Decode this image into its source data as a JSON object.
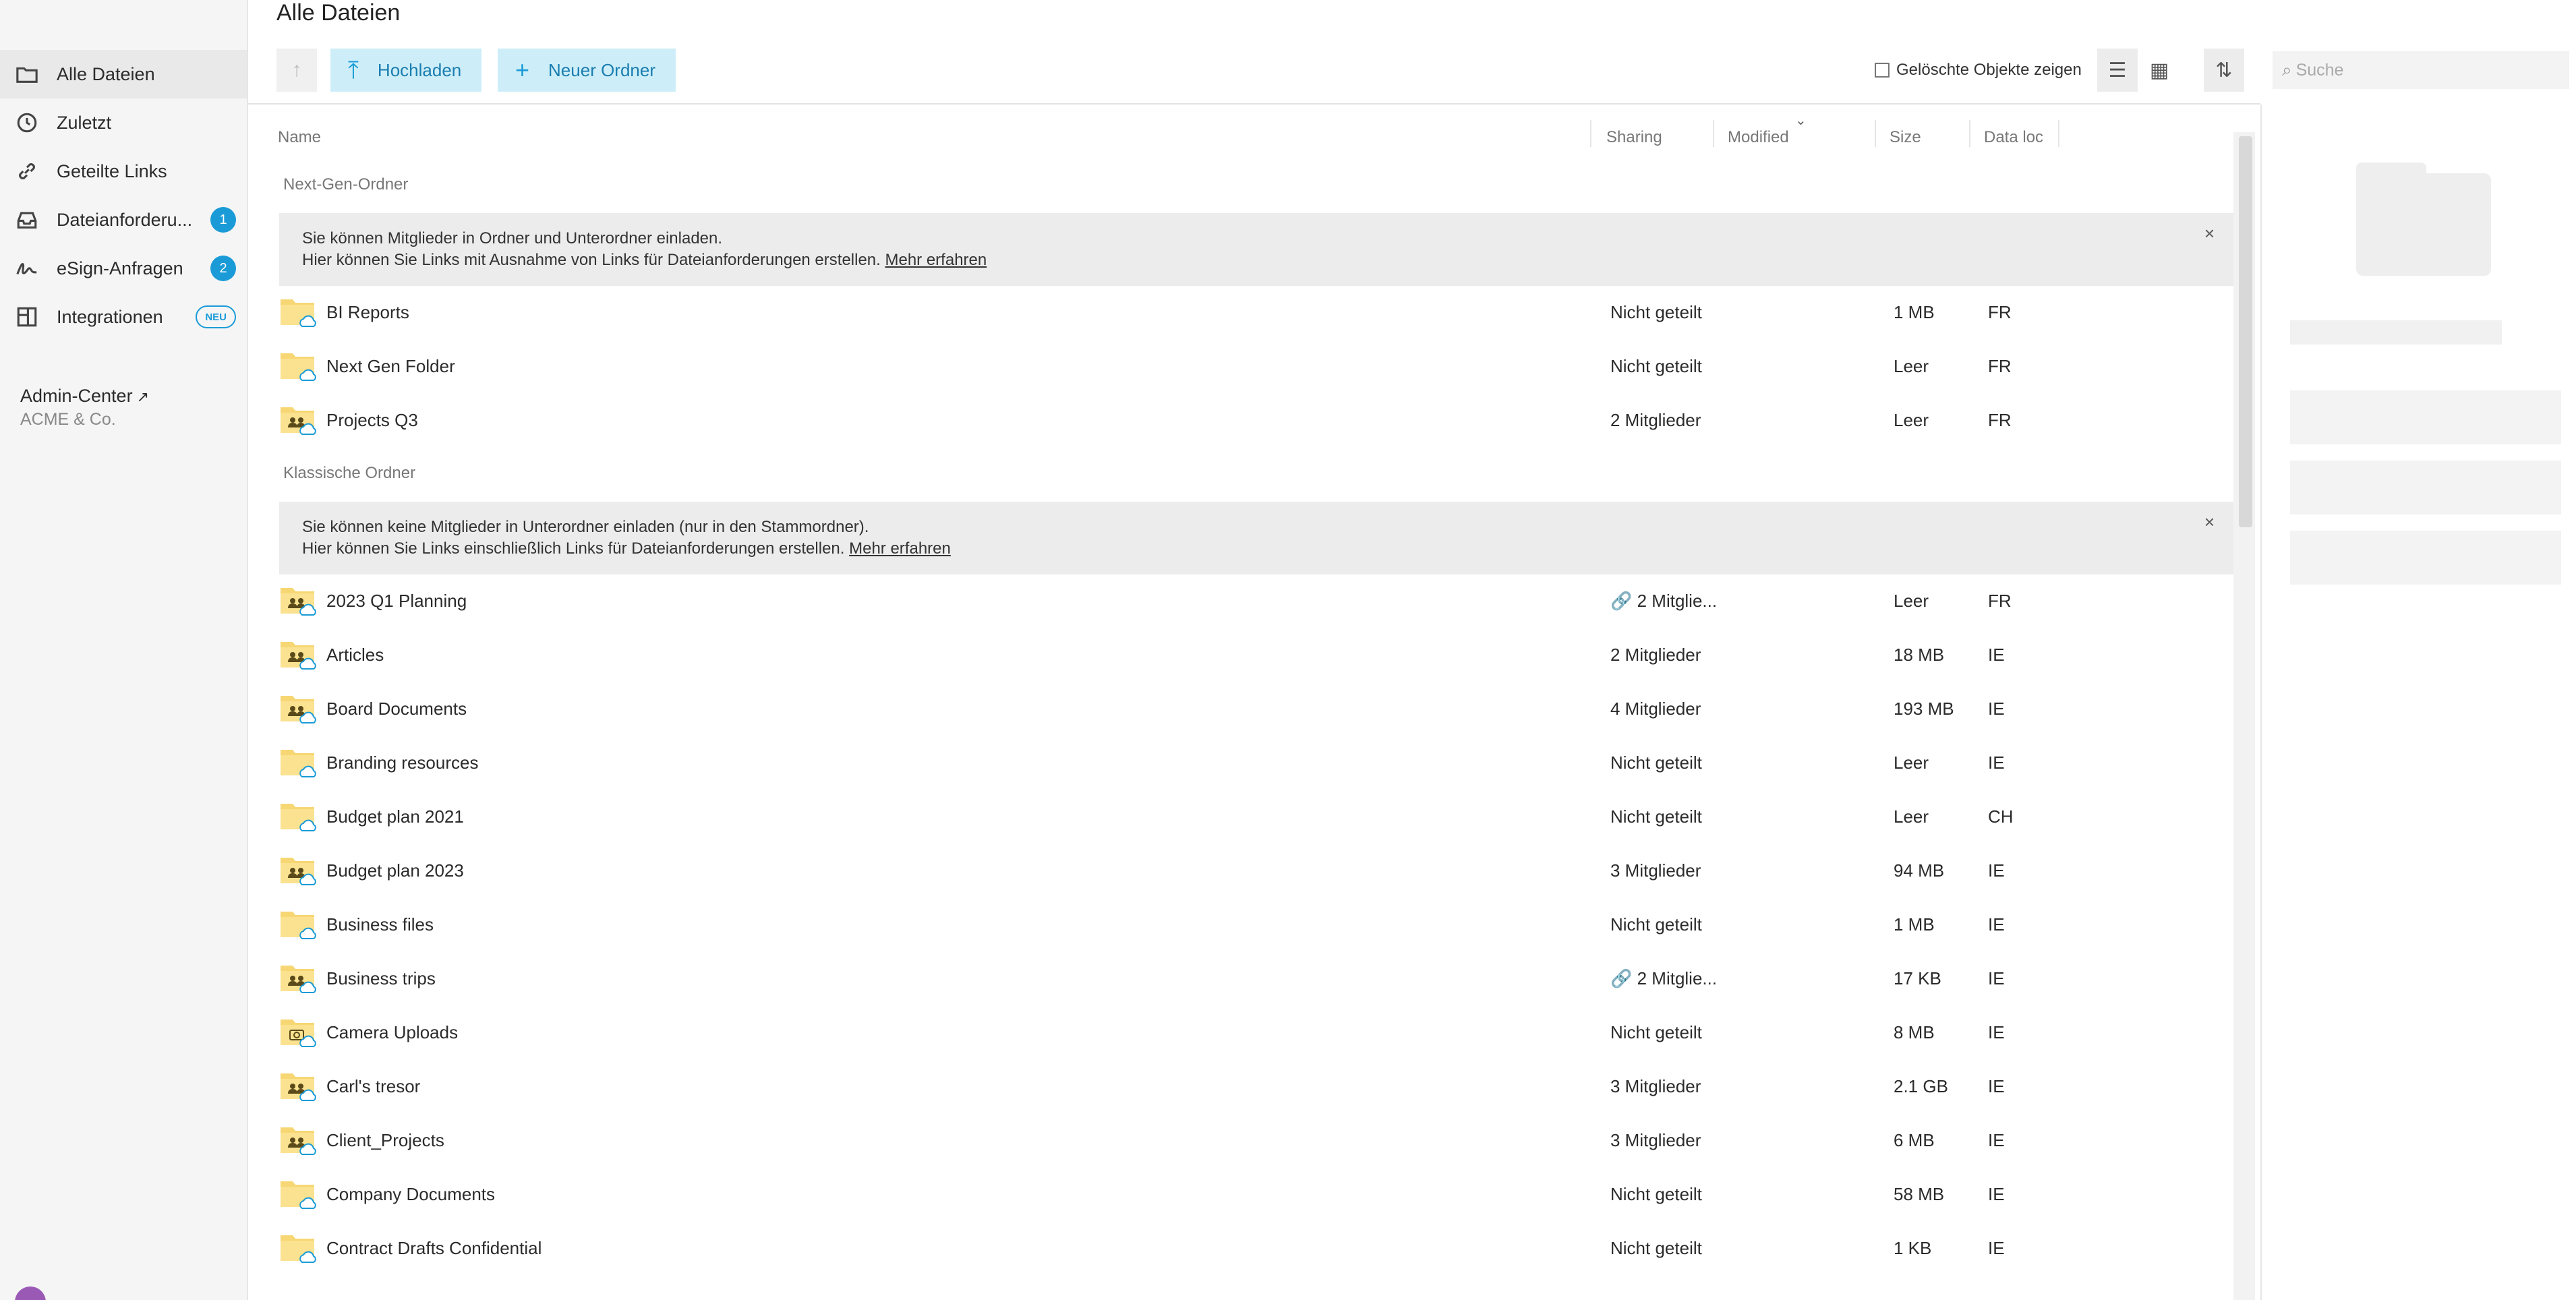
{
  "sidebar": {
    "items": [
      {
        "label": "Alle Dateien",
        "icon": "folder-icon",
        "active": true
      },
      {
        "label": "Zuletzt",
        "icon": "clock-icon"
      },
      {
        "label": "Geteilte Links",
        "icon": "link-icon"
      },
      {
        "label": "Dateianforderu...",
        "icon": "inbox-icon",
        "badge": "1"
      },
      {
        "label": "eSign-Anfragen",
        "icon": "signature-icon",
        "badge": "2"
      },
      {
        "label": "Integrationen",
        "icon": "integrations-icon",
        "tag": "NEU"
      }
    ],
    "admin_label": "Admin-Center",
    "company": "ACME & Co."
  },
  "header": {
    "title": "Alle Dateien"
  },
  "toolbar": {
    "upload_label": "Hochladen",
    "new_folder_label": "Neuer Ordner",
    "show_deleted_label": "Gelöschte Objekte zeigen",
    "search_placeholder": "Suche"
  },
  "columns": {
    "name": "Name",
    "sharing": "Sharing",
    "modified": "Modified",
    "size": "Size",
    "location": "Data loc"
  },
  "sections": {
    "next_gen": {
      "title": "Next-Gen-Ordner",
      "info_line1": "Sie können Mitglieder in Ordner und Unterordner einladen.",
      "info_line2": "Hier können Sie Links mit Ausnahme von Links für Dateianforderungen erstellen.",
      "info_link": "Mehr erfahren"
    },
    "classic": {
      "title": "Klassische Ordner",
      "info_line1": "Sie können keine Mitglieder in Unterordner einladen (nur in den Stammordner).",
      "info_line2": "Hier können Sie Links einschließlich Links für Dateianforderungen erstellen.",
      "info_link": "Mehr erfahren"
    }
  },
  "next_gen_rows": [
    {
      "name": "BI Reports",
      "sharing": "Nicht geteilt",
      "size": "1 MB",
      "loc": "FR",
      "icon": "folder-cloud-icon"
    },
    {
      "name": "Next Gen Folder",
      "sharing": "Nicht geteilt",
      "size": "Leer",
      "loc": "FR",
      "icon": "folder-cloud-icon"
    },
    {
      "name": "Projects Q3",
      "sharing": "2 Mitglieder",
      "size": "Leer",
      "loc": "FR",
      "icon": "shared-folder-cloud-icon"
    }
  ],
  "classic_rows": [
    {
      "name": "2023 Q1 Planning",
      "sharing": "🔗 2 Mitglie...",
      "size": "Leer",
      "loc": "FR",
      "icon": "shared-folder-cloud-icon"
    },
    {
      "name": "Articles",
      "sharing": "2 Mitglieder",
      "size": "18 MB",
      "loc": "IE",
      "icon": "shared-folder-cloud-icon"
    },
    {
      "name": "Board Documents",
      "sharing": "4 Mitglieder",
      "size": "193 MB",
      "loc": "IE",
      "icon": "shared-folder-cloud-icon"
    },
    {
      "name": "Branding resources",
      "sharing": "Nicht geteilt",
      "size": "Leer",
      "loc": "IE",
      "icon": "folder-cloud-icon"
    },
    {
      "name": "Budget plan 2021",
      "sharing": "Nicht geteilt",
      "size": "Leer",
      "loc": "CH",
      "icon": "folder-cloud-icon"
    },
    {
      "name": "Budget plan 2023",
      "sharing": "3 Mitglieder",
      "size": "94 MB",
      "loc": "IE",
      "icon": "shared-folder-cloud-icon"
    },
    {
      "name": "Business files",
      "sharing": "Nicht geteilt",
      "size": "1 MB",
      "loc": "IE",
      "icon": "folder-cloud-icon"
    },
    {
      "name": "Business trips",
      "sharing": "🔗 2 Mitglie...",
      "size": "17 KB",
      "loc": "IE",
      "icon": "shared-folder-cloud-icon"
    },
    {
      "name": "Camera Uploads",
      "sharing": "Nicht geteilt",
      "size": "8 MB",
      "loc": "IE",
      "icon": "camera-folder-cloud-icon"
    },
    {
      "name": "Carl's tresor",
      "sharing": "3 Mitglieder",
      "size": "2.1 GB",
      "loc": "IE",
      "icon": "shared-folder-cloud-icon"
    },
    {
      "name": "Client_Projects",
      "sharing": "3 Mitglieder",
      "size": "6 MB",
      "loc": "IE",
      "icon": "shared-folder-cloud-icon"
    },
    {
      "name": "Company Documents",
      "sharing": "Nicht geteilt",
      "size": "58 MB",
      "loc": "IE",
      "icon": "folder-cloud-icon"
    },
    {
      "name": "Contract Drafts Confidential",
      "sharing": "Nicht geteilt",
      "size": "1 KB",
      "loc": "IE",
      "icon": "folder-cloud-icon"
    }
  ],
  "colors": {
    "accent": "#1a9bd7",
    "button_bg": "#cdeef8",
    "folder": "#f7d774",
    "sidebar_bg": "#f5f5f5"
  }
}
